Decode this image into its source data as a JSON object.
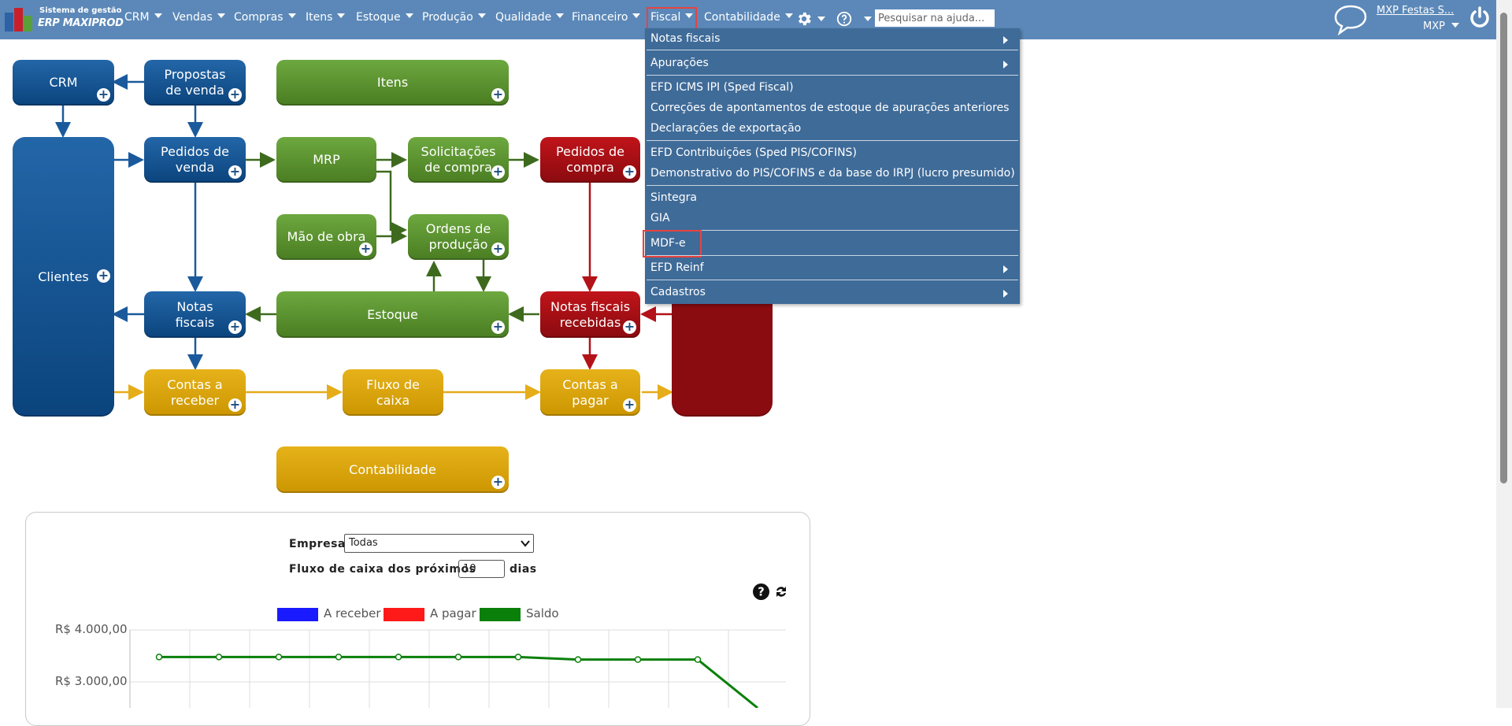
{
  "app": {
    "logo_line1": "Sistema de gestão",
    "logo_line2": "ERP MAXIPROD"
  },
  "nav": {
    "menus": [
      "CRM",
      "Vendas",
      "Compras",
      "Itens",
      "Estoque",
      "Produção",
      "Qualidade",
      "Financeiro",
      "Fiscal",
      "Contabilidade"
    ],
    "active_menu": "Fiscal",
    "search_placeholder": "Pesquisar na ajuda...",
    "user_name": "MXP Festas S...",
    "company": "MXP"
  },
  "fiscal_menu": {
    "items": [
      {
        "label": "Notas fiscais",
        "submenu": true
      },
      {
        "label": "Apurações",
        "submenu": true
      },
      {
        "label": "EFD ICMS IPI (Sped Fiscal)",
        "submenu": false
      },
      {
        "label": "Correções de apontamentos de estoque de apurações anteriores",
        "submenu": false
      },
      {
        "label": "Declarações de exportação",
        "submenu": false
      },
      {
        "label": "EFD Contribuições (Sped PIS/COFINS)",
        "submenu": false
      },
      {
        "label": "Demonstrativo do PIS/COFINS e da base do IRPJ (lucro presumido)",
        "submenu": false
      },
      {
        "label": "Sintegra",
        "submenu": false
      },
      {
        "label": "GIA",
        "submenu": false
      },
      {
        "label": "MDF-e",
        "submenu": false,
        "highlighted": true
      },
      {
        "label": "EFD Reinf",
        "submenu": true
      },
      {
        "label": "Cadastros",
        "submenu": true
      }
    ]
  },
  "flow": {
    "crm": "CRM",
    "propostas": "Propostas de venda",
    "itens": "Itens",
    "clientes": "Clientes",
    "pedidos_venda": "Pedidos de venda",
    "mrp": "MRP",
    "solicitacoes": "Solicitações de compra",
    "pedidos_compra": "Pedidos de compra",
    "mao_obra": "Mão de obra",
    "ordens": "Ordens de produção",
    "notas_fiscais": "Notas fiscais",
    "estoque": "Estoque",
    "nf_recebidas": "Notas fiscais recebidas",
    "contas_receber": "Contas a receber",
    "fluxo_caixa": "Fluxo de caixa",
    "contas_pagar": "Contas a pagar",
    "contabilidade": "Contabilidade"
  },
  "dashboard": {
    "empresa_label": "Empresa",
    "empresa_value": "Todas",
    "fluxo_label": "Fluxo de caixa dos próximos",
    "fluxo_days": "10",
    "dias_label": "dias"
  },
  "colors": {
    "topbar": "#5b88b8",
    "dropdown": "#3f6b98",
    "highlight": "#e8423f",
    "a_receber": "#1a1aff",
    "a_pagar": "#ff1a1a",
    "saldo": "#0a800a"
  },
  "chart_data": {
    "type": "line",
    "series": [
      {
        "name": "A receber",
        "values": []
      },
      {
        "name": "A pagar",
        "values": []
      },
      {
        "name": "Saldo",
        "values": [
          3480,
          3480,
          3480,
          3480,
          3480,
          3480,
          3480,
          3430,
          3430,
          3430,
          2500
        ]
      }
    ],
    "ytick_labels": [
      "R$ 4.000,00",
      "R$ 3.000,00"
    ],
    "yticks": [
      4000,
      3000
    ],
    "legend_position": "top",
    "grid": true
  }
}
